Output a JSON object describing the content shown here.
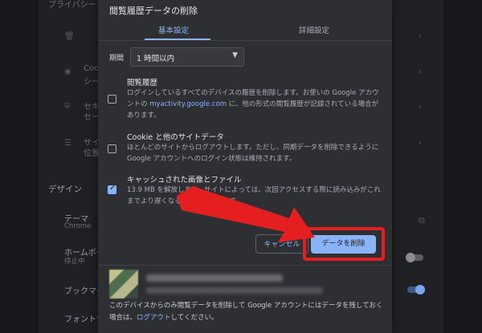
{
  "background": {
    "section_title_top": "プライバシー",
    "section_design": "デザイン",
    "rows": [
      {
        "text": "テーマ",
        "sub": "Chrome"
      },
      {
        "text": "ホームボタ",
        "sub": "停止中"
      },
      {
        "text": "ブックマー",
        "sub": ""
      },
      {
        "text": "フォントサ",
        "sub": ""
      }
    ],
    "side_rows": [
      {
        "text": "Coo",
        "sub": "シー"
      },
      {
        "text": "セキ",
        "sub": "セー"
      },
      {
        "text": "サイ",
        "sub": "位置"
      }
    ]
  },
  "dialog": {
    "title": "閲覧履歴データの削除",
    "tabs": [
      {
        "label": "基本設定",
        "active": true
      },
      {
        "label": "詳細設定",
        "active": false
      }
    ],
    "period_label": "期間",
    "period_value": "1 時間以内",
    "items": [
      {
        "title": "閲覧履歴",
        "desc_before": "ログインしているすべてのデバイスの履歴を削除します。お使いの Google アカウントの ",
        "link": "myactivity.google.com",
        "desc_after": " に、他の形式の閲覧履歴が記録されている場合があります。",
        "checked": false
      },
      {
        "title": "Cookie と他のサイトデータ",
        "desc": "ほとんどのサイトからログアウトします。ただし、同期データを削除できるように Google アカウントへのログイン状態は維持されます。",
        "checked": false
      },
      {
        "title": "キャッシュされた画像とファイル",
        "desc": "13.9 MB を解放します。サイトによっては、次回アクセスする際に読み込みがこれまでより遅くなる可能性があります。",
        "checked": true
      }
    ],
    "cancel_label": "キャンセル",
    "delete_label": "データを削除",
    "footer_before": "このデバイスからのみ閲覧データを削除して Google アカウントにはデータを残しておく場合は、",
    "footer_link": "ログアウト",
    "footer_after": "してください。"
  },
  "colors": {
    "accent": "#8ab4f8",
    "highlight_red": "#e51f1f",
    "dialog_bg": "#2d2f33"
  }
}
